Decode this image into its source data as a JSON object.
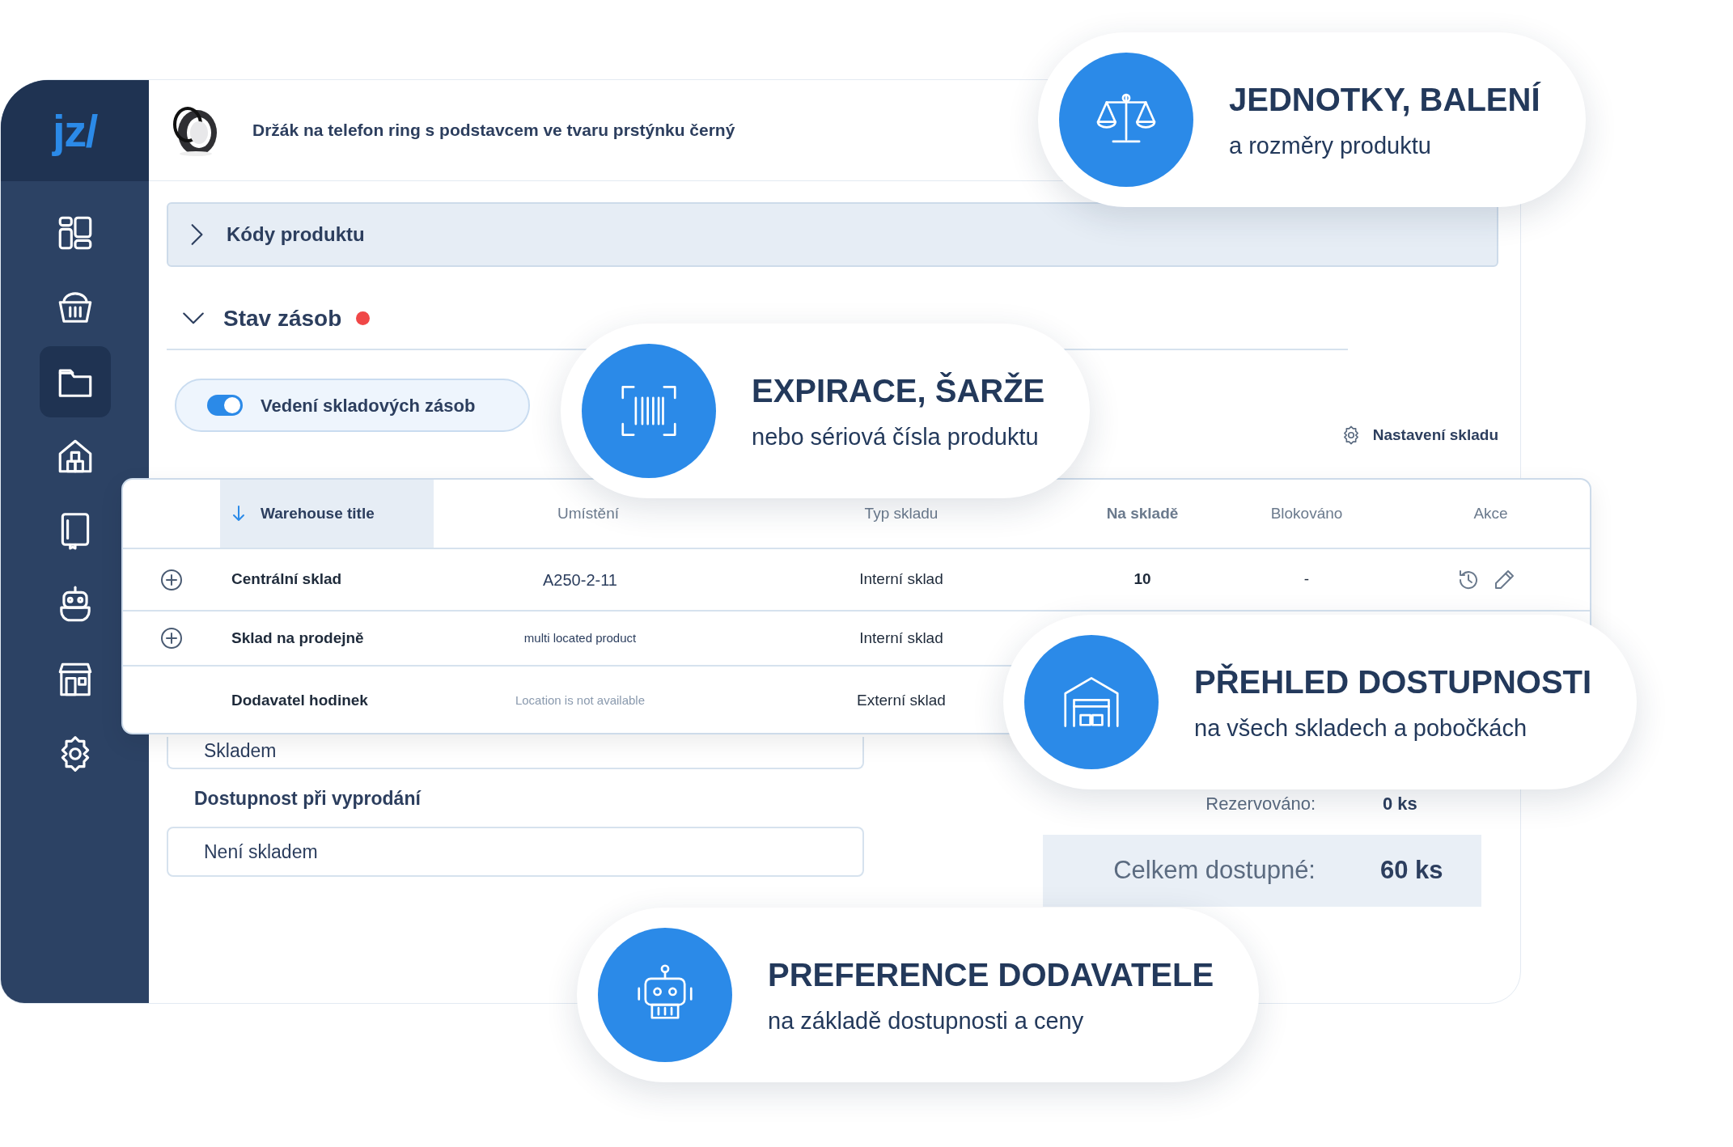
{
  "logo": "jz/",
  "sidebar": {
    "items": [
      {
        "selected": false
      },
      {
        "selected": false
      },
      {
        "selected": true
      },
      {
        "selected": false
      },
      {
        "selected": false
      },
      {
        "selected": false
      },
      {
        "selected": false
      },
      {
        "selected": false
      }
    ]
  },
  "product": {
    "title": "Držák na telefon ring s podstavcem ve tvaru prstýnku černý"
  },
  "sections": [
    {
      "title": "Kódy produktu",
      "expanded": false,
      "alert_dot": false
    },
    {
      "title": "Stav zásob",
      "expanded": true,
      "alert_dot": true
    }
  ],
  "stock_toggle": {
    "label": "Vedení skladových zásob",
    "on": true
  },
  "settings_link": "Nastavení skladu",
  "table": {
    "columns": [
      {
        "label": "Warehouse title",
        "sorted": true
      },
      {
        "label": "Umístění",
        "sorted": false
      },
      {
        "label": "Typ skladu",
        "sorted": false
      },
      {
        "label": "Na skladě",
        "sorted": false
      },
      {
        "label": "Blokováno",
        "sorted": false
      },
      {
        "label": "Akce",
        "sorted": false
      }
    ],
    "rows": [
      {
        "expandable": true,
        "title": "Centrální sklad",
        "location": "A250-2-11",
        "location_small": false,
        "location_muted": false,
        "type": "Interní sklad",
        "on_stock": "10",
        "blocked": "-",
        "actions": true
      },
      {
        "expandable": true,
        "title": "Sklad na prodejně",
        "location": "multi located product",
        "location_small": true,
        "location_muted": false,
        "type": "Interní sklad",
        "actions": false
      },
      {
        "expandable": false,
        "title": "Dodavatel hodinek",
        "location": "Location is not available",
        "location_small": true,
        "location_muted": true,
        "type": "Externí sklad",
        "actions": false
      }
    ]
  },
  "availability": {
    "in_stock_field": "Skladem",
    "sold_out_label": "Dostupnost při vyprodání",
    "sold_out_field": "Není skladem"
  },
  "summary": {
    "reserved_label": "Rezervováno:",
    "reserved_value": "0 ks",
    "total_label": "Celkem dostupné:",
    "total_value": "60 ks"
  },
  "callouts": [
    {
      "title": "JEDNOTKY, BALENÍ",
      "subtitle": "a rozměry produktu"
    },
    {
      "title": "EXPIRACE, ŠARŽE",
      "subtitle": "nebo sériová čísla produktu"
    },
    {
      "title": "PŘEHLED DOSTUPNOSTI",
      "subtitle": "na všech skladech a pobočkách"
    },
    {
      "title": "PREFERENCE DODAVATELE",
      "subtitle": "na základě dostupnosti a ceny"
    }
  ]
}
